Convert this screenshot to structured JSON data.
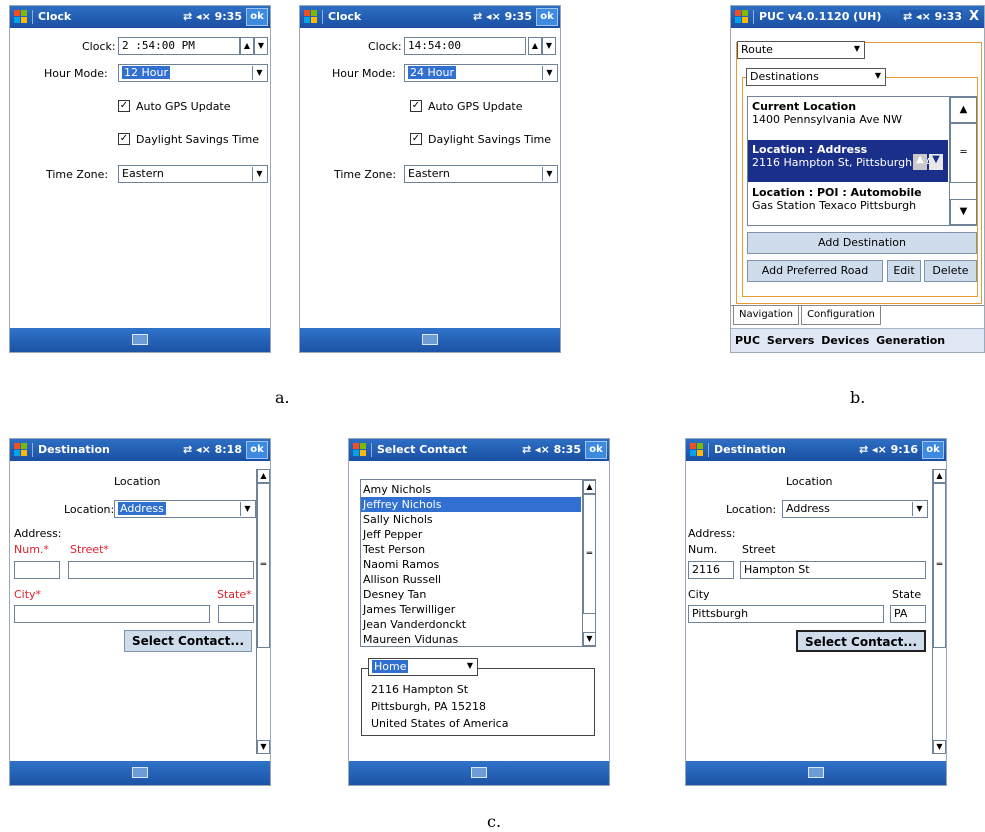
{
  "clock_12": {
    "title": "Clock",
    "time": "9:35",
    "ok": "ok",
    "clock_label": "Clock:",
    "clock_value": "2 :54:00  PM",
    "hour_mode_label": "Hour Mode:",
    "hour_mode_value": "12 Hour",
    "auto_gps_label": "Auto GPS Update",
    "dst_label": "Daylight Savings Time",
    "timezone_label": "Time Zone:",
    "timezone_value": "Eastern"
  },
  "clock_24": {
    "title": "Clock",
    "time": "9:35",
    "ok": "ok",
    "clock_label": "Clock:",
    "clock_value": "14:54:00",
    "hour_mode_label": "Hour Mode:",
    "hour_mode_value": "24 Hour",
    "auto_gps_label": "Auto GPS Update",
    "dst_label": "Daylight Savings Time",
    "timezone_label": "Time Zone:",
    "timezone_value": "Eastern"
  },
  "puc": {
    "title": "PUC v4.0.1120 (UH)",
    "time": "9:33",
    "close": "X",
    "route_value": "Route",
    "destinations_value": "Destinations",
    "items": [
      {
        "heading": "Current Location",
        "detail": "1400 Pennsylvania Ave NW"
      },
      {
        "heading": "Location : Address",
        "detail": "2116 Hampton St, Pittsburgh, PA"
      },
      {
        "heading": "Location : POI : Automobile",
        "detail": "Gas Station  Texaco  Pittsburgh"
      }
    ],
    "add_destination": "Add Destination",
    "add_preferred_road": "Add Preferred Road",
    "edit": "Edit",
    "delete": "Delete",
    "tabs": [
      "Navigation",
      "Configuration"
    ],
    "menu": [
      "PUC",
      "Servers",
      "Devices",
      "Generation"
    ]
  },
  "dest_empty": {
    "title": "Destination",
    "time": "8:18",
    "ok": "ok",
    "section_label": "Location",
    "location_label": "Location:",
    "location_value": "Address",
    "address_label": "Address:",
    "num_label": "Num.*",
    "street_label": "Street*",
    "city_label": "City*",
    "state_label": "State*",
    "select_contact": "Select Contact..."
  },
  "select_contact": {
    "title": "Select Contact",
    "time": "8:35",
    "ok": "ok",
    "contacts": [
      "Amy Nichols",
      "Jeffrey Nichols",
      "Sally Nichols",
      "Jeff Pepper",
      "Test Person",
      "Naomi Ramos",
      "Allison Russell",
      "Desney Tan",
      "James Terwilliger",
      "Jean Vanderdonckt",
      "Maureen Vidunas"
    ],
    "selected_index": 1,
    "address_type": "Home",
    "address_lines": [
      "2116 Hampton St",
      "Pittsburgh, PA 15218",
      "United States of America"
    ]
  },
  "dest_filled": {
    "title": "Destination",
    "time": "9:16",
    "ok": "ok",
    "section_label": "Location",
    "location_label": "Location:",
    "location_value": "Address",
    "address_label": "Address:",
    "num_label": "Num.",
    "street_label": "Street",
    "num_value": "2116",
    "street_value": "Hampton St",
    "city_label": "City",
    "state_label": "State",
    "city_value": "Pittsburgh",
    "state_value": "PA",
    "select_contact": "Select Contact..."
  },
  "captions": {
    "a": "a.",
    "b": "b.",
    "c": "c."
  }
}
